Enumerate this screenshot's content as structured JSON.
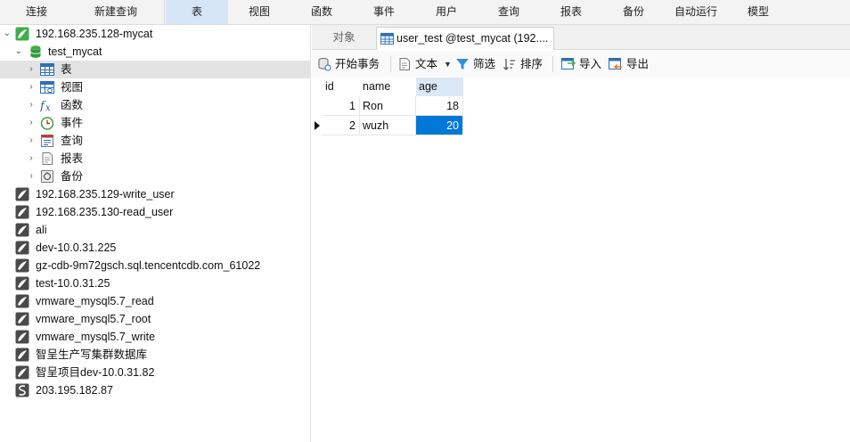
{
  "menu": {
    "items": [
      {
        "label": "连接"
      },
      {
        "label": "新建查询"
      },
      {
        "label": "表",
        "active": true
      },
      {
        "label": "视图"
      },
      {
        "label": "函数"
      },
      {
        "label": "事件"
      },
      {
        "label": "用户"
      },
      {
        "label": "查询"
      },
      {
        "label": "报表"
      },
      {
        "label": "备份"
      },
      {
        "label": "自动运行"
      },
      {
        "label": "模型"
      }
    ]
  },
  "tree": {
    "root_connection": "192.168.235.128-mycat",
    "database": "test_mycat",
    "categories": [
      {
        "label": "表",
        "icon": "table-icon"
      },
      {
        "label": "视图",
        "icon": "view-icon"
      },
      {
        "label": "函数",
        "icon": "function-icon"
      },
      {
        "label": "事件",
        "icon": "event-icon"
      },
      {
        "label": "查询",
        "icon": "query-icon"
      },
      {
        "label": "报表",
        "icon": "report-icon"
      },
      {
        "label": "备份",
        "icon": "backup-icon"
      }
    ],
    "connections": [
      {
        "label": "192.168.235.129-write_user",
        "icon": "mysql-connection-icon"
      },
      {
        "label": "192.168.235.130-read_user",
        "icon": "mysql-connection-icon"
      },
      {
        "label": "ali",
        "icon": "mysql-connection-icon"
      },
      {
        "label": "dev-10.0.31.225",
        "icon": "mysql-connection-icon"
      },
      {
        "label": "gz-cdb-9m72gsch.sql.tencentcdb.com_61022",
        "icon": "mysql-connection-icon"
      },
      {
        "label": "test-10.0.31.25",
        "icon": "mysql-connection-icon"
      },
      {
        "label": "vmware_mysql5.7_read",
        "icon": "mysql-connection-icon"
      },
      {
        "label": "vmware_mysql5.7_root",
        "icon": "mysql-connection-icon"
      },
      {
        "label": "vmware_mysql5.7_write",
        "icon": "mysql-connection-icon"
      },
      {
        "label": "智呈生产写集群数据库",
        "icon": "mysql-connection-icon"
      },
      {
        "label": "智呈项目dev-10.0.31.82",
        "icon": "mysql-connection-icon"
      },
      {
        "label": "203.195.182.87",
        "icon": "mssql-connection-icon"
      }
    ]
  },
  "tabs": {
    "objects": "对象",
    "active": "user_test @test_mycat (192...."
  },
  "toolbar": {
    "begin_transaction": "开始事务",
    "text": "文本",
    "filter": "筛选",
    "sort": "排序",
    "import": "导入",
    "export": "导出"
  },
  "grid": {
    "columns": [
      "id",
      "name",
      "age"
    ],
    "rows": [
      {
        "id": "1",
        "name": "Ron",
        "age": "18"
      },
      {
        "id": "2",
        "name": "wuzh",
        "age": "20"
      }
    ]
  },
  "colors": {
    "accent": "#0078d7",
    "connection_green": "#3fae49",
    "selection": "#e3e3e3"
  }
}
